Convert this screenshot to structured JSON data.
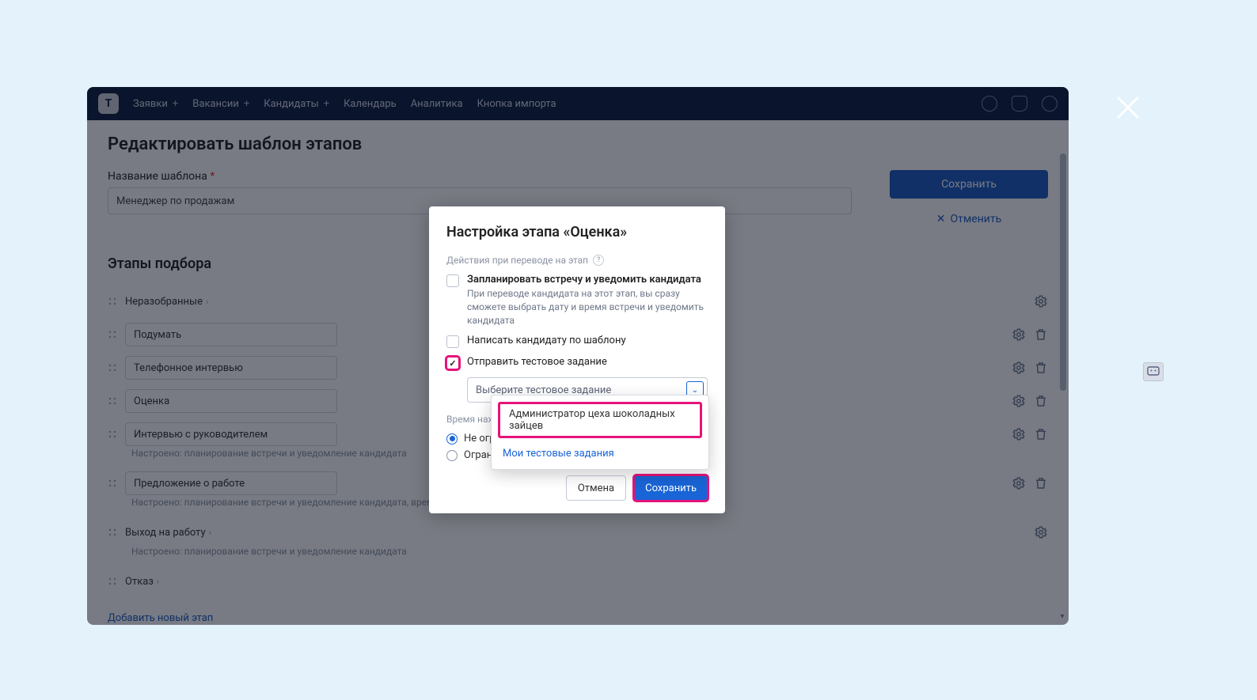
{
  "logo_letter": "T",
  "nav": {
    "requests": "Заявки",
    "vacancies": "Вакансии",
    "candidates": "Кандидаты",
    "calendar": "Календарь",
    "analytics": "Аналитика",
    "import_btn": "Кнопка импорта"
  },
  "page_title": "Редактировать шаблон этапов",
  "template_name_label": "Название шаблона",
  "template_name_value": "Менеджер по продажам",
  "save_btn": "Сохранить",
  "cancel_btn_top": "Отменить",
  "stages_section_title": "Этапы подбора",
  "stages": {
    "s0": "Неразобранные",
    "s1": "Подумать",
    "s2": "Телефонное интервью",
    "s3": "Оценка",
    "s4": "Интервью с руководителем",
    "s4_sub": "Настроено: планирование встречи и уведомление кандидата",
    "s5": "Предложение о работе",
    "s5_sub": "Настроено: планирование встречи и уведомление кандидата, время на…",
    "s6": "Выход на работу",
    "s6_sub": "Настроено: планирование встречи и уведомление кандидата",
    "s7": "Отказ"
  },
  "add_stage_link": "Добавить новый этап",
  "modal": {
    "title": "Настройка этапа «Оценка»",
    "actions_label": "Действия при переводе на этап",
    "chk1_title": "Запланировать встречу и уведомить кандидата",
    "chk1_desc": "При переводе кандидата на этот этап, вы сразу сможете выбрать дату и время встречи и уведомить кандидата",
    "chk2_title": "Написать кандидату по шаблону",
    "chk3_title": "Отправить тестовое задание",
    "select_placeholder": "Выберите тестовое задание",
    "time_label": "Время нахо",
    "radio_unlimited": "Не огра",
    "radio_limited": "Огранич",
    "cancel": "Отмена",
    "save": "Сохранить"
  },
  "dropdown": {
    "option1": "Администратор цеха шоколадных зайцев",
    "my_tasks_link": "Мои тестовые задания"
  }
}
